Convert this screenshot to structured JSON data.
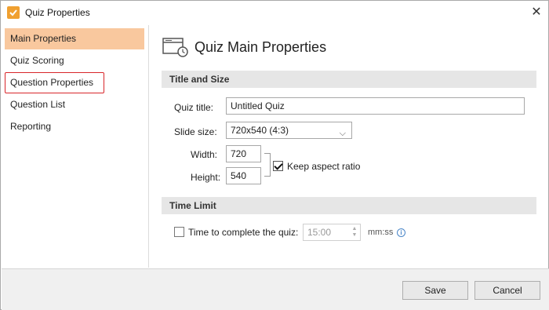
{
  "window": {
    "title": "Quiz Properties",
    "close_icon": "close-icon",
    "app_icon": "checkbox-app-icon"
  },
  "sidebar": {
    "items": [
      {
        "label": "Main Properties",
        "state": "selected"
      },
      {
        "label": "Quiz Scoring"
      },
      {
        "label": "Question Properties",
        "state": "highlighted"
      },
      {
        "label": "Question List"
      },
      {
        "label": "Reporting"
      }
    ]
  },
  "main": {
    "heading": "Quiz Main Properties",
    "heading_icon": "quiz-properties-icon",
    "sections": [
      {
        "title": "Title and Size"
      },
      {
        "title": "Time Limit"
      }
    ],
    "quiz_title": {
      "label": "Quiz title:",
      "value": "Untitled Quiz"
    },
    "slide_size": {
      "label": "Slide size:",
      "value": "720x540 (4:3)"
    },
    "width": {
      "label": "Width:",
      "value": "720"
    },
    "height": {
      "label": "Height:",
      "value": "540"
    },
    "aspect_ratio": {
      "label": "Keep aspect ratio",
      "checked": true
    },
    "time_limit": {
      "label": "Time to complete the quiz:",
      "checked": false,
      "value": "15:00",
      "unit": "mm:ss",
      "info_icon": "info-icon"
    }
  },
  "footer": {
    "save_label": "Save",
    "cancel_label": "Cancel"
  },
  "colors": {
    "selected_bg": "#f9c89e",
    "highlight_border": "#d8262a",
    "section_bg": "#e6e6e6",
    "app_icon": "#f0a030"
  }
}
